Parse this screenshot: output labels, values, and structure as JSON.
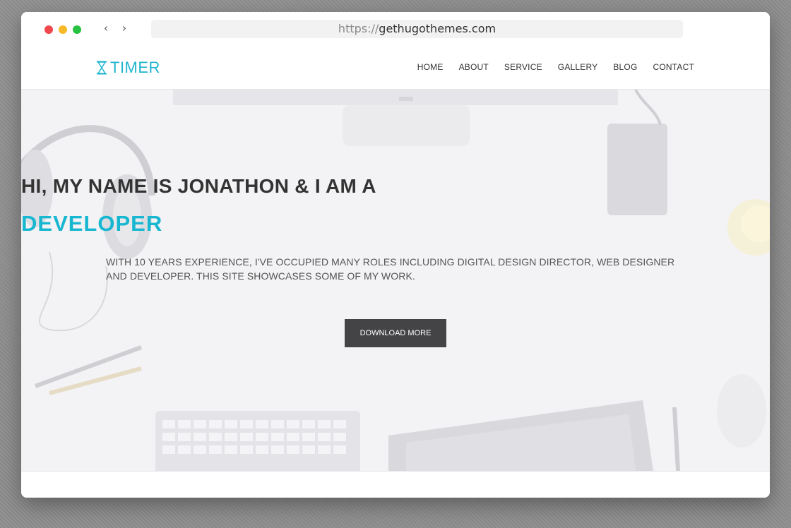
{
  "browser": {
    "url_scheme": "https://",
    "url_host": "gethugothemes.com"
  },
  "site": {
    "logo_text": "TIMER",
    "nav": [
      "HOME",
      "ABOUT",
      "SERVICE",
      "GALLERY",
      "BLOG",
      "CONTACT"
    ]
  },
  "hero": {
    "headline": "HI, MY NAME IS JONATHON & I AM A",
    "role": "DEVELOPER",
    "description": "WITH 10 YEARS EXPERIENCE, I'VE OCCUPIED MANY ROLES INCLUDING DIGITAL DESIGN DIRECTOR, WEB DESIGNER AND DEVELOPER. THIS SITE SHOWCASES SOME OF MY WORK.",
    "cta_label": "DOWNLOAD MORE"
  },
  "colors": {
    "accent": "#17b6d1",
    "button": "#444346",
    "text": "#333333"
  },
  "icons": {
    "logo": "hourglass-icon",
    "back": "chevron-left-icon",
    "forward": "chevron-right-icon"
  }
}
